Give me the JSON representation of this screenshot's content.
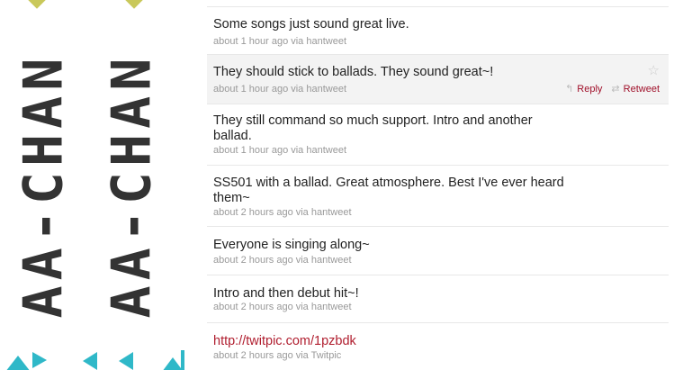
{
  "banner": {
    "vertical_text": "AA-CHAN"
  },
  "tweets": [
    {
      "text": "Some songs just sound great live.",
      "meta": "about 1 hour ago via hantweet"
    },
    {
      "text": "They should stick to ballads. They sound great~!",
      "meta": "about 1 hour ago via hantweet"
    },
    {
      "text": "They still command so much support. Intro and another ballad.",
      "meta": "about 1 hour ago via hantweet"
    },
    {
      "text": "SS501 with a ballad. Great atmosphere. Best I've ever heard them~",
      "meta": "about 2 hours ago via hantweet"
    },
    {
      "text": "Everyone is singing along~",
      "meta": "about 2 hours ago via hantweet"
    },
    {
      "text": "Intro and then debut hit~!",
      "meta": "about 2 hours ago via hantweet"
    },
    {
      "text": "http://twitpic.com/1pzbdk",
      "meta": "about 2 hours ago via Twitpic"
    }
  ],
  "actions": {
    "reply_label": "Reply",
    "retweet_label": "Retweet",
    "reply_icon": "reply-arrow",
    "retweet_icon": "retweet-arrows",
    "favorite_icon": "star-outline"
  },
  "colors": {
    "accent": "#2fb8c8",
    "diamond": "#c9c85a",
    "link": "#b01e2f"
  }
}
